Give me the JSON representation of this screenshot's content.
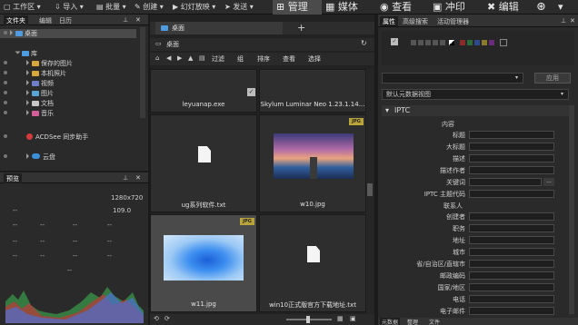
{
  "toolbar": {
    "workspace": "工作区",
    "import": "导入",
    "batch": "批量",
    "create": "创建",
    "slideshow": "幻灯放映",
    "send": "发送"
  },
  "modes": [
    {
      "label": "管理",
      "active": true
    },
    {
      "label": "媒体"
    },
    {
      "label": "查看"
    },
    {
      "label": "冲印"
    },
    {
      "label": "编辑"
    }
  ],
  "left_tabs": [
    "文件夹",
    "编辑",
    "日历"
  ],
  "tree": {
    "desktop": "桌面",
    "library": "库",
    "items": [
      "保存的图片",
      "本机照片",
      "视频",
      "图片",
      "文档",
      "音乐"
    ],
    "sync": "ACDSee 同步助手",
    "cloud": "云盘"
  },
  "preview": {
    "title": "预览",
    "dims": "1280x720",
    "zoom": "109.0 ",
    "dash": "--"
  },
  "center": {
    "tab": "桌面",
    "path": "桌面",
    "toolbar": [
      "过滤",
      "组",
      "排序",
      "查看",
      "选择"
    ]
  },
  "thumbs": [
    {
      "name": "leyuanap.exe"
    },
    {
      "name": "Skylum Luminar Neo 1.23.1.14..."
    },
    {
      "name": "ug系列软件.txt"
    },
    {
      "name": "w10.jpg",
      "badge": "JPG"
    },
    {
      "name": "w11.jpg",
      "badge": "JPG"
    },
    {
      "name": "win10正式版官方下载地址.txt"
    }
  ],
  "right_tabs": [
    "属性",
    "高级搜索",
    "活动管理器"
  ],
  "apply_label": "应用",
  "view_select": "默认元数据视图",
  "iptc": {
    "section": "IPTC",
    "content_group": "内容",
    "content_fields": [
      "标题",
      "大标题",
      "描述",
      "描述作者",
      "关键词",
      "IPTC 主题代码"
    ],
    "contact_group": "联系人",
    "contact_fields": [
      "创建者",
      "职务",
      "地址",
      "城市",
      "省/自治区/直辖市",
      "邮政编码",
      "国家/地区",
      "电话",
      "电子邮件"
    ]
  },
  "bottom_tabs": [
    "元数据",
    "整理",
    "文件"
  ],
  "colors": {
    "accent": "#3a7bd5",
    "badge": "#b8a43a"
  }
}
